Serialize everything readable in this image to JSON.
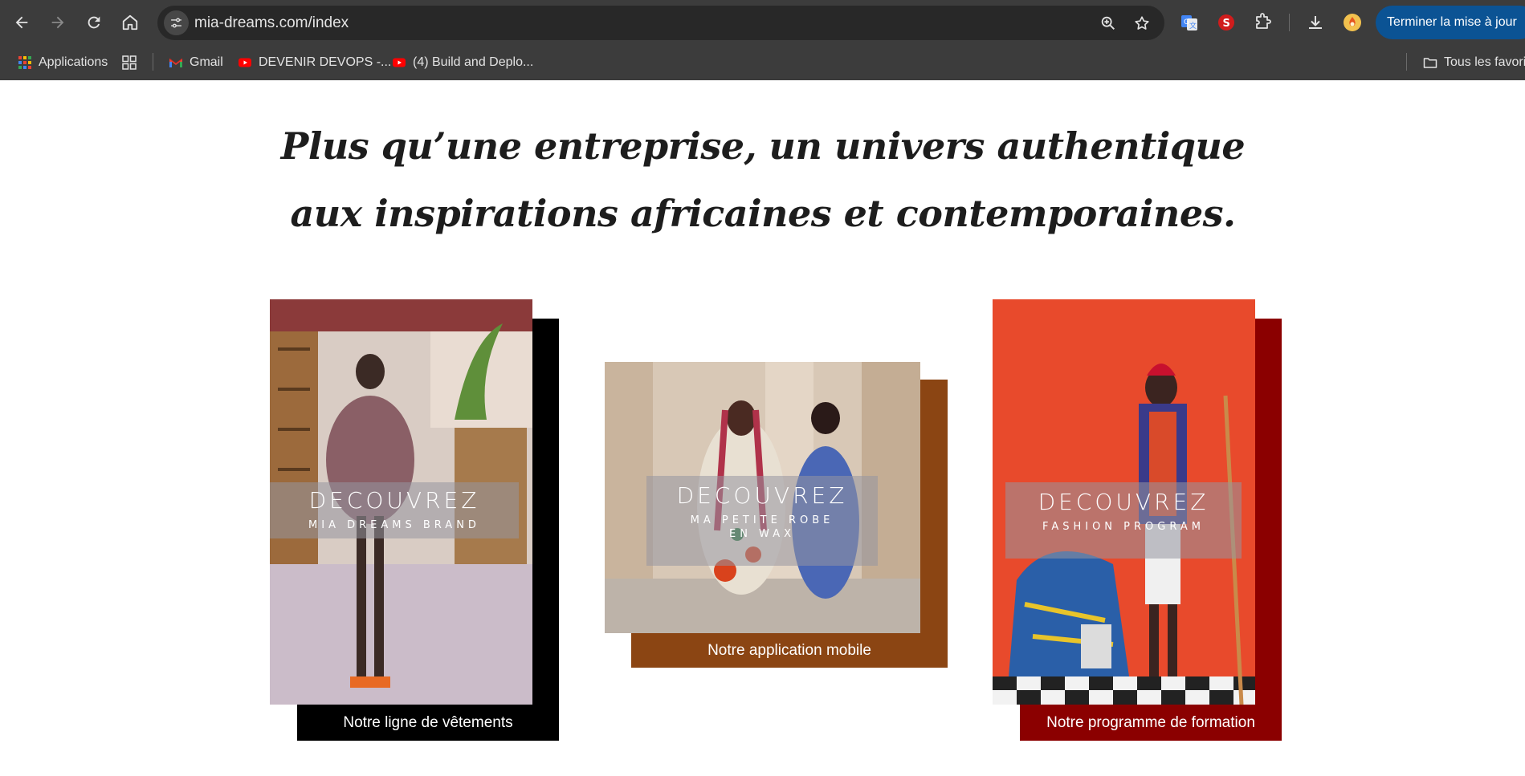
{
  "browser": {
    "url": "mia-dreams.com/index",
    "update_button": "Terminer la mise à jour",
    "bookmarks": [
      {
        "label": "Applications",
        "icon": "apps-grid-icon"
      },
      {
        "label": "Gmail",
        "icon": "gmail-icon"
      },
      {
        "label": "DEVENIR DEVOPS -...",
        "icon": "youtube-icon"
      },
      {
        "label": "(4) Build and Deplo...",
        "icon": "youtube-icon"
      }
    ],
    "all_bookmarks": "Tous les favoris"
  },
  "hero": {
    "tagline": "Plus qu’une entreprise, un univers authentique aux inspirations africaines et contemporaines."
  },
  "cards": [
    {
      "overlay_title": "DECOUVREZ",
      "overlay_subtitle": "MIA DREAMS BRAND",
      "caption": "Notre ligne de vêtements",
      "accent_color": "#000000"
    },
    {
      "overlay_title": "DECOUVREZ",
      "overlay_subtitle": "MA PETITE ROBE EN WAX",
      "caption": "Notre application mobile",
      "accent_color": "#8b4513"
    },
    {
      "overlay_title": "DECOUVREZ",
      "overlay_subtitle": "FASHION PROGRAM",
      "caption": "Notre programme de formation",
      "accent_color": "#8b0000"
    }
  ]
}
